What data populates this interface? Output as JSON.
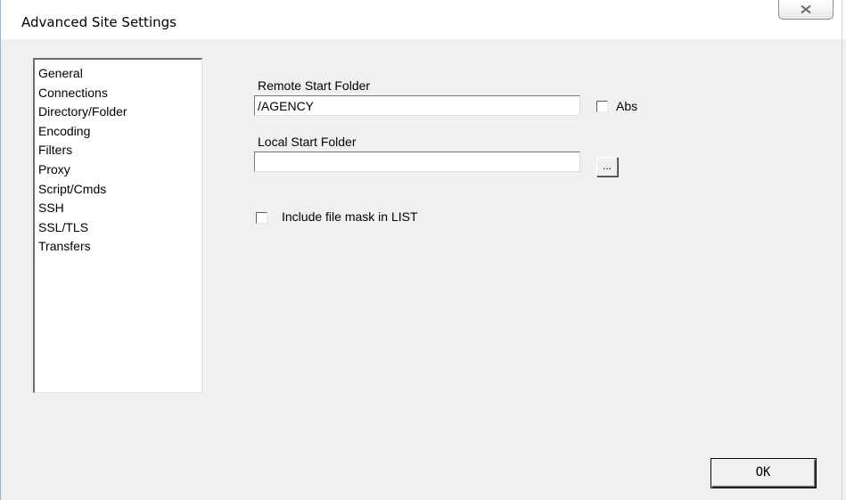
{
  "window": {
    "title": "Advanced Site Settings"
  },
  "icons": {
    "close": "close-icon"
  },
  "categories": [
    "General",
    "Connections",
    "Directory/Folder",
    "Encoding",
    "Filters",
    "Proxy",
    "Script/Cmds",
    "SSH",
    "SSL/TLS",
    "Transfers"
  ],
  "remote_start_folder": {
    "label": "Remote Start Folder",
    "value": "/AGENCY",
    "abs_label": "Abs",
    "abs_checked": false
  },
  "local_start_folder": {
    "label": "Local Start Folder",
    "value": "",
    "browse_label": "..."
  },
  "include_file_mask": {
    "label": "Include file mask in LIST",
    "checked": false
  },
  "buttons": {
    "ok": "OK"
  }
}
